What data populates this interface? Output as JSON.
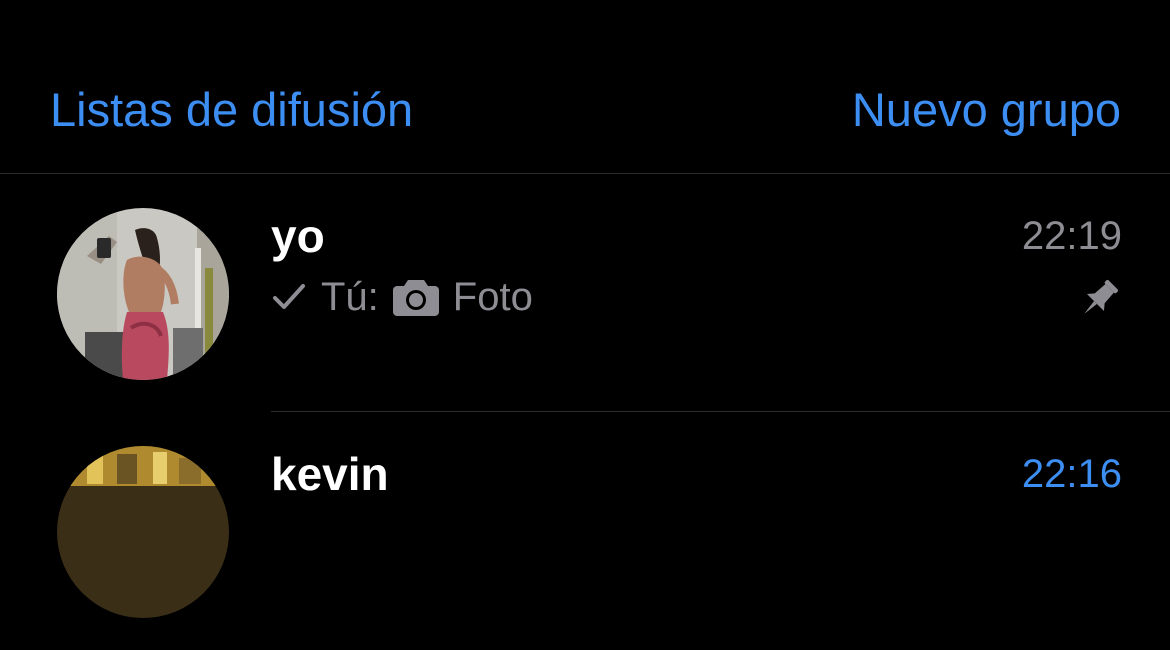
{
  "header": {
    "broadcast_label": "Listas de difusión",
    "new_group_label": "Nuevo grupo"
  },
  "chats": [
    {
      "name": "yo",
      "time": "22:19",
      "preview_sender": "Tú:",
      "preview_text": "Foto",
      "status_icon": "single-check-icon",
      "media_icon": "camera-icon",
      "pinned": true
    },
    {
      "name": "kevin",
      "time": "22:16",
      "unread": true
    }
  ],
  "colors": {
    "background": "#000000",
    "accent": "#3d8ef2",
    "secondary_text": "#8d8d93",
    "divider": "#2c2c2e"
  }
}
